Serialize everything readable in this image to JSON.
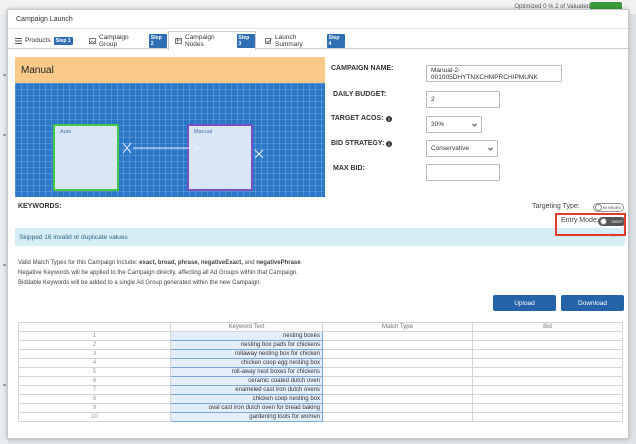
{
  "background": {
    "top_right_text": "Optimized 0 % 2 of Valuated"
  },
  "modal": {
    "title": "Campaign Launch"
  },
  "tabs": [
    {
      "label": "Products",
      "badge": "Step 1",
      "icon": "list-icon"
    },
    {
      "label": "Campaign Group",
      "badge": "Step 2",
      "icon": "image-icon"
    },
    {
      "label": "Campaign Nodes",
      "badge": "Step 3",
      "icon": "grid-icon"
    },
    {
      "label": "Launch Summary",
      "badge": "Step 4",
      "icon": "check-square-icon"
    }
  ],
  "banner": {
    "title": "Manual"
  },
  "canvas": {
    "auto_label": "Auto",
    "manual_label": "Manual"
  },
  "form": {
    "campaign_name_label": "CAMPAIGN NAME:",
    "campaign_name_value": "Manual-2-001005DHYTNXCHMPRCHIPMUNK",
    "daily_budget_label": "DAILY BUDGET:",
    "daily_budget_value": "2",
    "target_acos_label": "TARGET ACOS:",
    "target_acos_value": "30%",
    "bid_strategy_label": "BID STRATEGY:",
    "bid_strategy_value": "Conservative",
    "max_bid_label": "MAX BID:",
    "max_bid_value": ""
  },
  "keywords": {
    "label": "KEYWORDS:",
    "targeting_type_label": "Targeting Type:",
    "targeting_toggle_text": "KEYWORD",
    "entry_mode_label": "Entry Mode:",
    "entry_mode_toggle_text": "SHEET"
  },
  "alert": {
    "text": "Skipped 16 invalid or duplicate values",
    "close": "×"
  },
  "info": {
    "line1_prefix": "Valid Match Types for this Campaign include: ",
    "line1_types": "exact, broad, phrase, negativeExact,",
    "line1_and": " and ",
    "line1_last": "negativePhrase",
    "line1_end": ".",
    "line2": "Negative Keywords will be applied to the Campaign directly, affecting all Ad Groups within that Campaign.",
    "line3": "Biddable Keywords will be added to a single Ad Group generated within the new Campaign."
  },
  "buttons": {
    "upload": "Upload",
    "download": "Download"
  },
  "table": {
    "headers": [
      "",
      "Keyword Text",
      "Match Type",
      "Bid"
    ],
    "rows": [
      {
        "num": "1",
        "kw": "nesting boxes"
      },
      {
        "num": "2",
        "kw": "nesting box pads for chickens"
      },
      {
        "num": "3",
        "kw": "rollaway nesting box for chicken"
      },
      {
        "num": "4",
        "kw": "chicken coop egg nesting box"
      },
      {
        "num": "5",
        "kw": "roll-away nest boxes for chickens"
      },
      {
        "num": "6",
        "kw": "ceramic coated dutch oven"
      },
      {
        "num": "7",
        "kw": "enameled cast iron dutch ovens"
      },
      {
        "num": "8",
        "kw": "chicken coop nesting box"
      },
      {
        "num": "9",
        "kw": "oval cast iron dutch oven for bread baking"
      },
      {
        "num": "10",
        "kw": "gardening tools for women"
      }
    ]
  }
}
